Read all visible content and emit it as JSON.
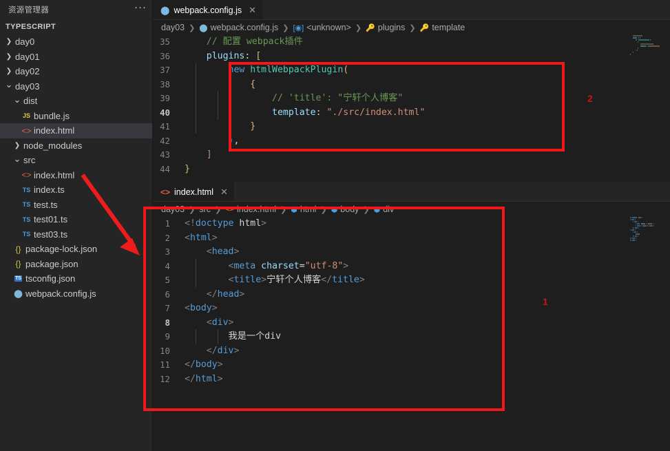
{
  "sidebar": {
    "header": "资源管理器",
    "more_label": "···",
    "section_title": "TYPESCRIPT",
    "items": [
      {
        "label": "day0",
        "icon": "chevron-right-icon",
        "filetype": "folder",
        "indent": 0,
        "selected": false
      },
      {
        "label": "day01",
        "icon": "chevron-right-icon",
        "filetype": "folder",
        "indent": 0,
        "selected": false
      },
      {
        "label": "day02",
        "icon": "chevron-right-icon",
        "filetype": "folder",
        "indent": 0,
        "selected": false
      },
      {
        "label": "day03",
        "icon": "chevron-down-icon",
        "filetype": "folder",
        "indent": 0,
        "selected": false
      },
      {
        "label": "dist",
        "icon": "chevron-down-icon",
        "filetype": "folder",
        "indent": 1,
        "selected": false
      },
      {
        "label": "bundle.js",
        "icon": "js-file-icon",
        "filetype": "js",
        "indent": 2,
        "selected": false
      },
      {
        "label": "index.html",
        "icon": "html-file-icon",
        "filetype": "html",
        "indent": 2,
        "selected": true
      },
      {
        "label": "node_modules",
        "icon": "chevron-right-icon",
        "filetype": "folder",
        "indent": 1,
        "selected": false
      },
      {
        "label": "src",
        "icon": "chevron-down-icon",
        "filetype": "folder",
        "indent": 1,
        "selected": false
      },
      {
        "label": "index.html",
        "icon": "html-file-icon",
        "filetype": "html",
        "indent": 2,
        "selected": false
      },
      {
        "label": "index.ts",
        "icon": "ts-file-icon",
        "filetype": "ts",
        "indent": 2,
        "selected": false
      },
      {
        "label": "test.ts",
        "icon": "ts-file-icon",
        "filetype": "ts",
        "indent": 2,
        "selected": false
      },
      {
        "label": "test01.ts",
        "icon": "ts-file-icon",
        "filetype": "ts",
        "indent": 2,
        "selected": false
      },
      {
        "label": "test03.ts",
        "icon": "ts-file-icon",
        "filetype": "ts",
        "indent": 2,
        "selected": false
      },
      {
        "label": "package-lock.json",
        "icon": "json-file-icon",
        "filetype": "json",
        "indent": 1,
        "selected": false
      },
      {
        "label": "package.json",
        "icon": "json-file-icon",
        "filetype": "json",
        "indent": 1,
        "selected": false
      },
      {
        "label": "tsconfig.json",
        "icon": "tsconfig-file-icon",
        "filetype": "tsbox",
        "indent": 1,
        "selected": false
      },
      {
        "label": "webpack.config.js",
        "icon": "webpack-file-icon",
        "filetype": "wp",
        "indent": 1,
        "selected": false
      }
    ]
  },
  "editor_top": {
    "tab": {
      "label": "webpack.config.js",
      "icon": "webpack-file-icon",
      "close_label": "✕",
      "active": true
    },
    "breadcrumb": [
      {
        "label": "day03",
        "icon": ""
      },
      {
        "label": "webpack.config.js",
        "icon": "webpack-file-icon"
      },
      {
        "label": "<unknown>",
        "icon": "symbol-object-icon"
      },
      {
        "label": "plugins",
        "icon": "symbol-key-icon"
      },
      {
        "label": "template",
        "icon": "symbol-key-icon"
      }
    ],
    "first_line_number": 35,
    "active_line_number": 40,
    "lines": [
      {
        "n": 35,
        "tokens": [
          {
            "c": "t-cmt",
            "t": "    // 配置 webpack插件"
          }
        ]
      },
      {
        "n": 36,
        "tokens": [
          {
            "c": "t-prop",
            "t": "    plugins"
          },
          {
            "c": "t-plain",
            "t": ": "
          },
          {
            "c": "t-br-y",
            "t": "["
          }
        ]
      },
      {
        "n": 37,
        "tokens": [
          {
            "c": "t-kw",
            "t": "        new "
          },
          {
            "c": "t-cls",
            "t": "htmlWebpackPlugin"
          },
          {
            "c": "t-br-y",
            "t": "("
          }
        ]
      },
      {
        "n": 38,
        "tokens": [
          {
            "c": "t-br-y",
            "t": "            {"
          }
        ]
      },
      {
        "n": 39,
        "tokens": [
          {
            "c": "t-cmt",
            "t": "                // 'title': \"宁轩个人博客\""
          }
        ]
      },
      {
        "n": 40,
        "tokens": [
          {
            "c": "t-prop",
            "t": "                template"
          },
          {
            "c": "t-plain",
            "t": ": "
          },
          {
            "c": "t-str",
            "t": "\"./src/index.html\""
          }
        ]
      },
      {
        "n": 41,
        "tokens": [
          {
            "c": "t-br-y",
            "t": "            }"
          }
        ]
      },
      {
        "n": 42,
        "tokens": [
          {
            "c": "t-br-b",
            "t": "        )"
          },
          {
            "c": "t-plain",
            "t": ","
          }
        ]
      },
      {
        "n": 43,
        "tokens": [
          {
            "c": "t-br-p",
            "t": "    ]"
          }
        ]
      },
      {
        "n": 44,
        "tokens": [
          {
            "c": "t-br-y",
            "t": "}"
          }
        ]
      }
    ]
  },
  "editor_bottom": {
    "tab": {
      "label": "index.html",
      "icon": "html-file-icon",
      "close_label": "✕",
      "active": true
    },
    "breadcrumb": [
      {
        "label": "day03",
        "icon": ""
      },
      {
        "label": "src",
        "icon": ""
      },
      {
        "label": "index.html",
        "icon": "html-file-icon"
      },
      {
        "label": "html",
        "icon": "symbol-tag-icon"
      },
      {
        "label": "body",
        "icon": "symbol-tag-icon"
      },
      {
        "label": "div",
        "icon": "symbol-tag-icon"
      }
    ],
    "first_line_number": 1,
    "active_line_number": 8,
    "lines": [
      {
        "n": 1,
        "tokens": [
          {
            "c": "t-punct",
            "t": "<!"
          },
          {
            "c": "t-tagname",
            "t": "doctype"
          },
          {
            "c": "t-plain",
            "t": " html"
          },
          {
            "c": "t-punct",
            "t": ">"
          }
        ]
      },
      {
        "n": 2,
        "tokens": [
          {
            "c": "t-punct",
            "t": "<"
          },
          {
            "c": "t-tagname",
            "t": "html"
          },
          {
            "c": "t-punct",
            "t": ">"
          }
        ]
      },
      {
        "n": 3,
        "tokens": [
          {
            "c": "t-punct",
            "t": "    <"
          },
          {
            "c": "t-tagname",
            "t": "head"
          },
          {
            "c": "t-punct",
            "t": ">"
          }
        ]
      },
      {
        "n": 4,
        "tokens": [
          {
            "c": "t-punct",
            "t": "        <"
          },
          {
            "c": "t-tagname",
            "t": "meta"
          },
          {
            "c": "t-attr",
            "t": " charset"
          },
          {
            "c": "t-plain",
            "t": "="
          },
          {
            "c": "t-str",
            "t": "\"utf-8\""
          },
          {
            "c": "t-punct",
            "t": ">"
          }
        ]
      },
      {
        "n": 5,
        "tokens": [
          {
            "c": "t-punct",
            "t": "        <"
          },
          {
            "c": "t-tagname",
            "t": "title"
          },
          {
            "c": "t-punct",
            "t": ">"
          },
          {
            "c": "t-text",
            "t": "宁轩个人博客"
          },
          {
            "c": "t-punct",
            "t": "</"
          },
          {
            "c": "t-tagname",
            "t": "title"
          },
          {
            "c": "t-punct",
            "t": ">"
          }
        ]
      },
      {
        "n": 6,
        "tokens": [
          {
            "c": "t-punct",
            "t": "    </"
          },
          {
            "c": "t-tagname",
            "t": "head"
          },
          {
            "c": "t-punct",
            "t": ">"
          }
        ]
      },
      {
        "n": 7,
        "tokens": [
          {
            "c": "t-punct",
            "t": "<"
          },
          {
            "c": "t-tagname",
            "t": "body"
          },
          {
            "c": "t-punct",
            "t": ">"
          }
        ]
      },
      {
        "n": 8,
        "tokens": [
          {
            "c": "t-punct",
            "t": "    <"
          },
          {
            "c": "t-tagname",
            "t": "div"
          },
          {
            "c": "t-punct",
            "t": ">"
          }
        ]
      },
      {
        "n": 9,
        "tokens": [
          {
            "c": "t-text",
            "t": "        我是一个div"
          }
        ]
      },
      {
        "n": 10,
        "tokens": [
          {
            "c": "t-punct",
            "t": "    </"
          },
          {
            "c": "t-tagname",
            "t": "div"
          },
          {
            "c": "t-punct",
            "t": ">"
          }
        ]
      },
      {
        "n": 11,
        "tokens": [
          {
            "c": "t-punct",
            "t": "</"
          },
          {
            "c": "t-tagname",
            "t": "body"
          },
          {
            "c": "t-punct",
            "t": ">"
          }
        ]
      },
      {
        "n": 12,
        "tokens": [
          {
            "c": "t-punct",
            "t": "</"
          },
          {
            "c": "t-tagname",
            "t": "html"
          },
          {
            "c": "t-punct",
            "t": ">"
          }
        ]
      }
    ]
  },
  "annotations": {
    "color": "#f01818",
    "number_color": "#c41616",
    "marker_1": "1",
    "marker_2": "2",
    "arrow_label": "arrow-pointing-to-index-html-editor"
  },
  "colors": {
    "background": "#1e1e1e",
    "sidebar_background": "#252526",
    "selection": "#37373d",
    "accent_red": "#f01818",
    "ts_blue": "#4f9bd6",
    "html_orange": "#e2603a",
    "json_yellow": "#cfc04a"
  }
}
